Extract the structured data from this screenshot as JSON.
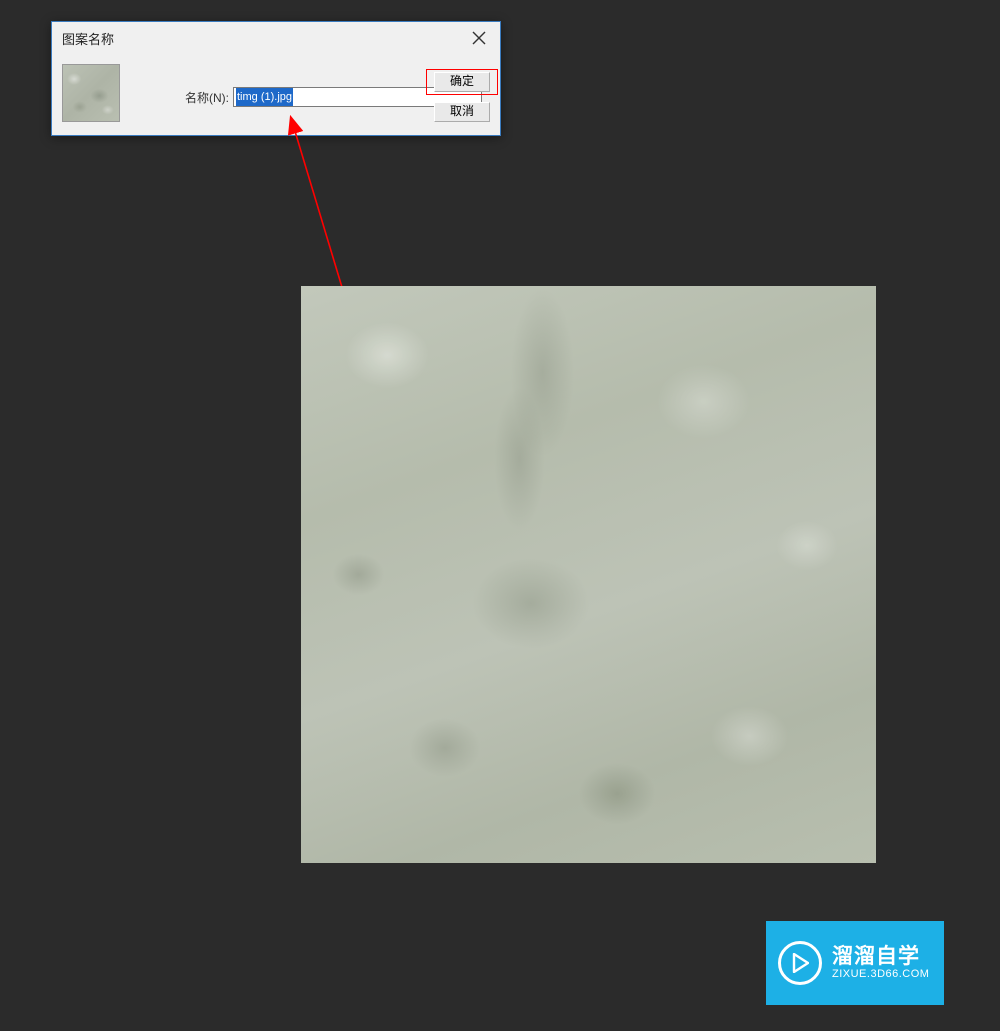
{
  "dialog": {
    "title": "图案名称",
    "close_icon": "close-icon",
    "name_label": "名称(N):",
    "name_value": "timg (1).jpg",
    "ok_label": "确定",
    "cancel_label": "取消"
  },
  "colors": {
    "highlight": "#ff0000",
    "selection_bg": "#1e69c9",
    "dialog_border": "#3a7bbf",
    "app_bg": "#2b2b2b",
    "watermark_bg": "#1db0e6"
  },
  "watermark": {
    "title": "溜溜自学",
    "subtitle": "ZIXUE.3D66.COM",
    "icon": "play-icon"
  }
}
